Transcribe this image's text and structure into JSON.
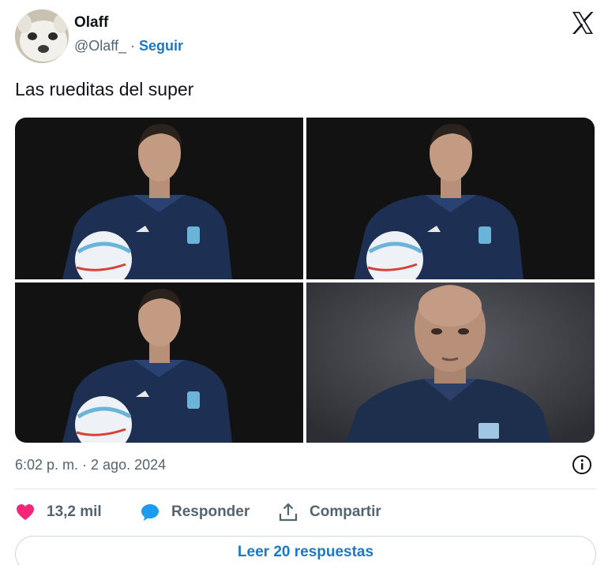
{
  "author": {
    "name": "Olaff",
    "handle": "@Olaff_",
    "separator": "·",
    "follow_label": "Seguir"
  },
  "tweet": {
    "text": "Las rueditas del super"
  },
  "media": {
    "images": [
      {
        "alt": "coach-portrait"
      },
      {
        "alt": "coach-portrait"
      },
      {
        "alt": "coach-portrait"
      },
      {
        "alt": "bald-man-portrait"
      }
    ]
  },
  "meta": {
    "timestamp": "6:02 p. m. · 2 ago. 2024"
  },
  "actions": {
    "likes": "13,2 mil",
    "reply_label": "Responder",
    "share_label": "Compartir"
  },
  "footer": {
    "read_replies_label": "Leer 20 respuestas"
  },
  "colors": {
    "accent": "#1d78c1",
    "like": "#f4267a",
    "text_secondary": "#536471"
  }
}
